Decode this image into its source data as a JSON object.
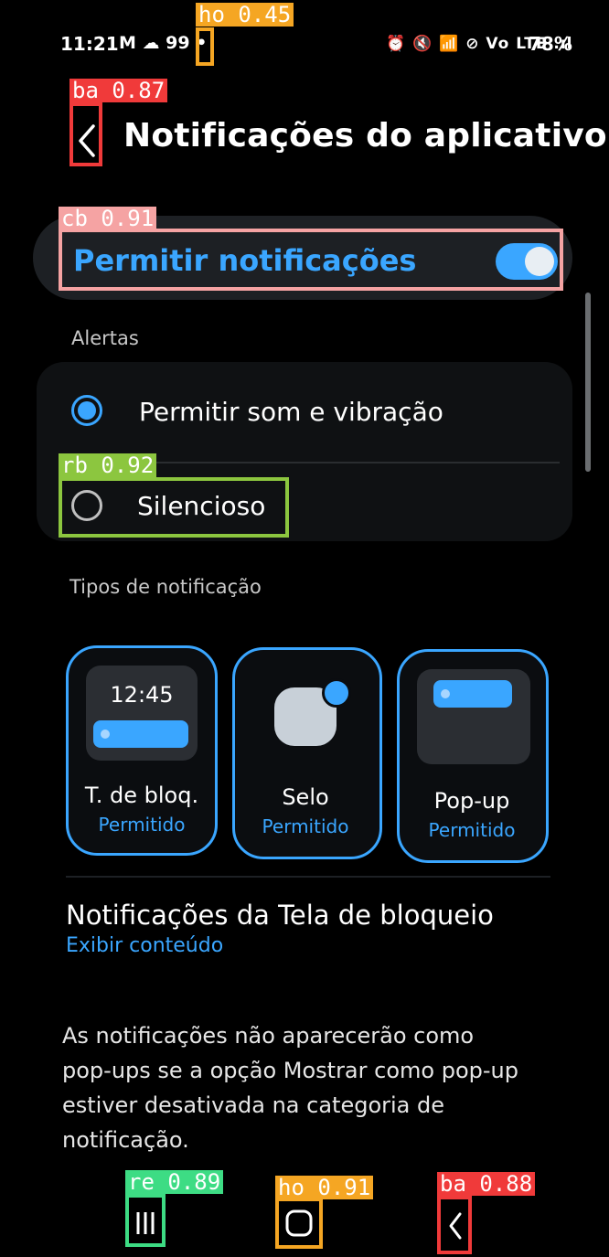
{
  "status_bar": {
    "time": "11:21",
    "left_icons": "M ☁ 99 •",
    "right_icons": "⏰ 🔇 📶 ⊘ Vo LTE .ıl",
    "battery": "78%"
  },
  "header": {
    "title": "Notificações do aplicativo"
  },
  "allow_notifications": {
    "label": "Permitir notificações",
    "enabled": true
  },
  "alerts": {
    "header": "Alertas",
    "options": [
      {
        "label": "Permitir som e vibração",
        "selected": true
      },
      {
        "label": "Silencioso",
        "selected": false
      }
    ]
  },
  "notification_types": {
    "header": "Tipos de notificação",
    "items": [
      {
        "name": "T. de bloq.",
        "status": "Permitido",
        "preview_time": "12:45"
      },
      {
        "name": "Selo",
        "status": "Permitido"
      },
      {
        "name": "Pop-up",
        "status": "Permitido"
      }
    ]
  },
  "lockscreen": {
    "title": "Notificações da Tela de bloqueio",
    "value": "Exibir conteúdo"
  },
  "info": {
    "text": "As notificações não aparecerão como pop-ups se a opção Mostrar como pop-up estiver desativada na categoria de notificação."
  },
  "detections": [
    {
      "label": "ho 0.45",
      "color": "#f5a623"
    },
    {
      "label": "ba 0.87",
      "color": "#f03a3a"
    },
    {
      "label": "cb 0.91",
      "color": "#f5a3a3"
    },
    {
      "label": "rb 0.92",
      "color": "#8cc63f"
    },
    {
      "label": "re 0.89",
      "color": "#3ddc84"
    },
    {
      "label": "ho 0.91",
      "color": "#f5a623"
    },
    {
      "label": "ba 0.88",
      "color": "#f03a3a"
    }
  ],
  "colors": {
    "accent": "#3aa6ff",
    "background": "#000000",
    "card": "#1d2024"
  },
  "nav_bar": {
    "recents": "recents-icon",
    "home": "home-icon",
    "back": "back-icon"
  }
}
